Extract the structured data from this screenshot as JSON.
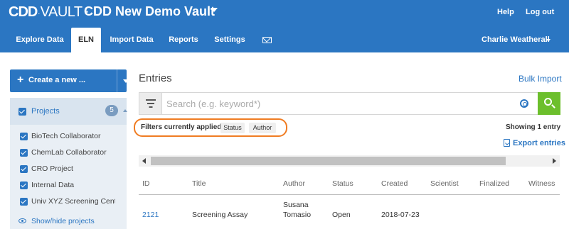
{
  "header": {
    "logo_brand": "CDD",
    "logo_product": "VAULT",
    "vault_name": "CDD New Demo Vault",
    "help_label": "Help",
    "logout_label": "Log out"
  },
  "nav": {
    "tabs": [
      {
        "label": "Explore Data",
        "active": false
      },
      {
        "label": "ELN",
        "active": true
      },
      {
        "label": "Import Data",
        "active": false
      },
      {
        "label": "Reports",
        "active": false
      },
      {
        "label": "Settings",
        "active": false
      }
    ],
    "mail_icon": "envelope-icon",
    "user_name": "Charlie Weatherall"
  },
  "sidebar": {
    "create_label": "Create a new ...",
    "projects": {
      "title": "Projects",
      "count": "5",
      "items": [
        {
          "label": "BioTech Collaborator",
          "checked": true
        },
        {
          "label": "ChemLab Collaborator",
          "checked": true
        },
        {
          "label": "CRO Project",
          "checked": true
        },
        {
          "label": "Internal Data",
          "checked": true
        },
        {
          "label": "Univ XYZ Screening Center",
          "checked": true
        }
      ],
      "show_hide_label": "Show/hide projects"
    }
  },
  "main": {
    "title": "Entries",
    "bulk_import_label": "Bulk Import",
    "search": {
      "placeholder": "Search (e.g. keyword*)",
      "value": ""
    },
    "filters": {
      "label": "Filters currently applied:",
      "chips": [
        "Status",
        "Author"
      ]
    },
    "showing": "Showing 1 entry",
    "export_label": "Export entries",
    "table": {
      "columns": [
        "ID",
        "Title",
        "Author",
        "Status",
        "Created",
        "Scientist",
        "Finalized",
        "Witness"
      ],
      "rows": [
        {
          "id": "2121",
          "title": "Screening Assay",
          "author_line1": "Susana",
          "author_line2": "Tomasio",
          "status": "Open",
          "created": "2018-07-23",
          "scientist": "",
          "finalized": "",
          "witness": ""
        }
      ]
    }
  },
  "colors": {
    "brand_blue": "#2b76c2",
    "search_green": "#6cbf2c",
    "highlight_orange": "#f07c22"
  }
}
